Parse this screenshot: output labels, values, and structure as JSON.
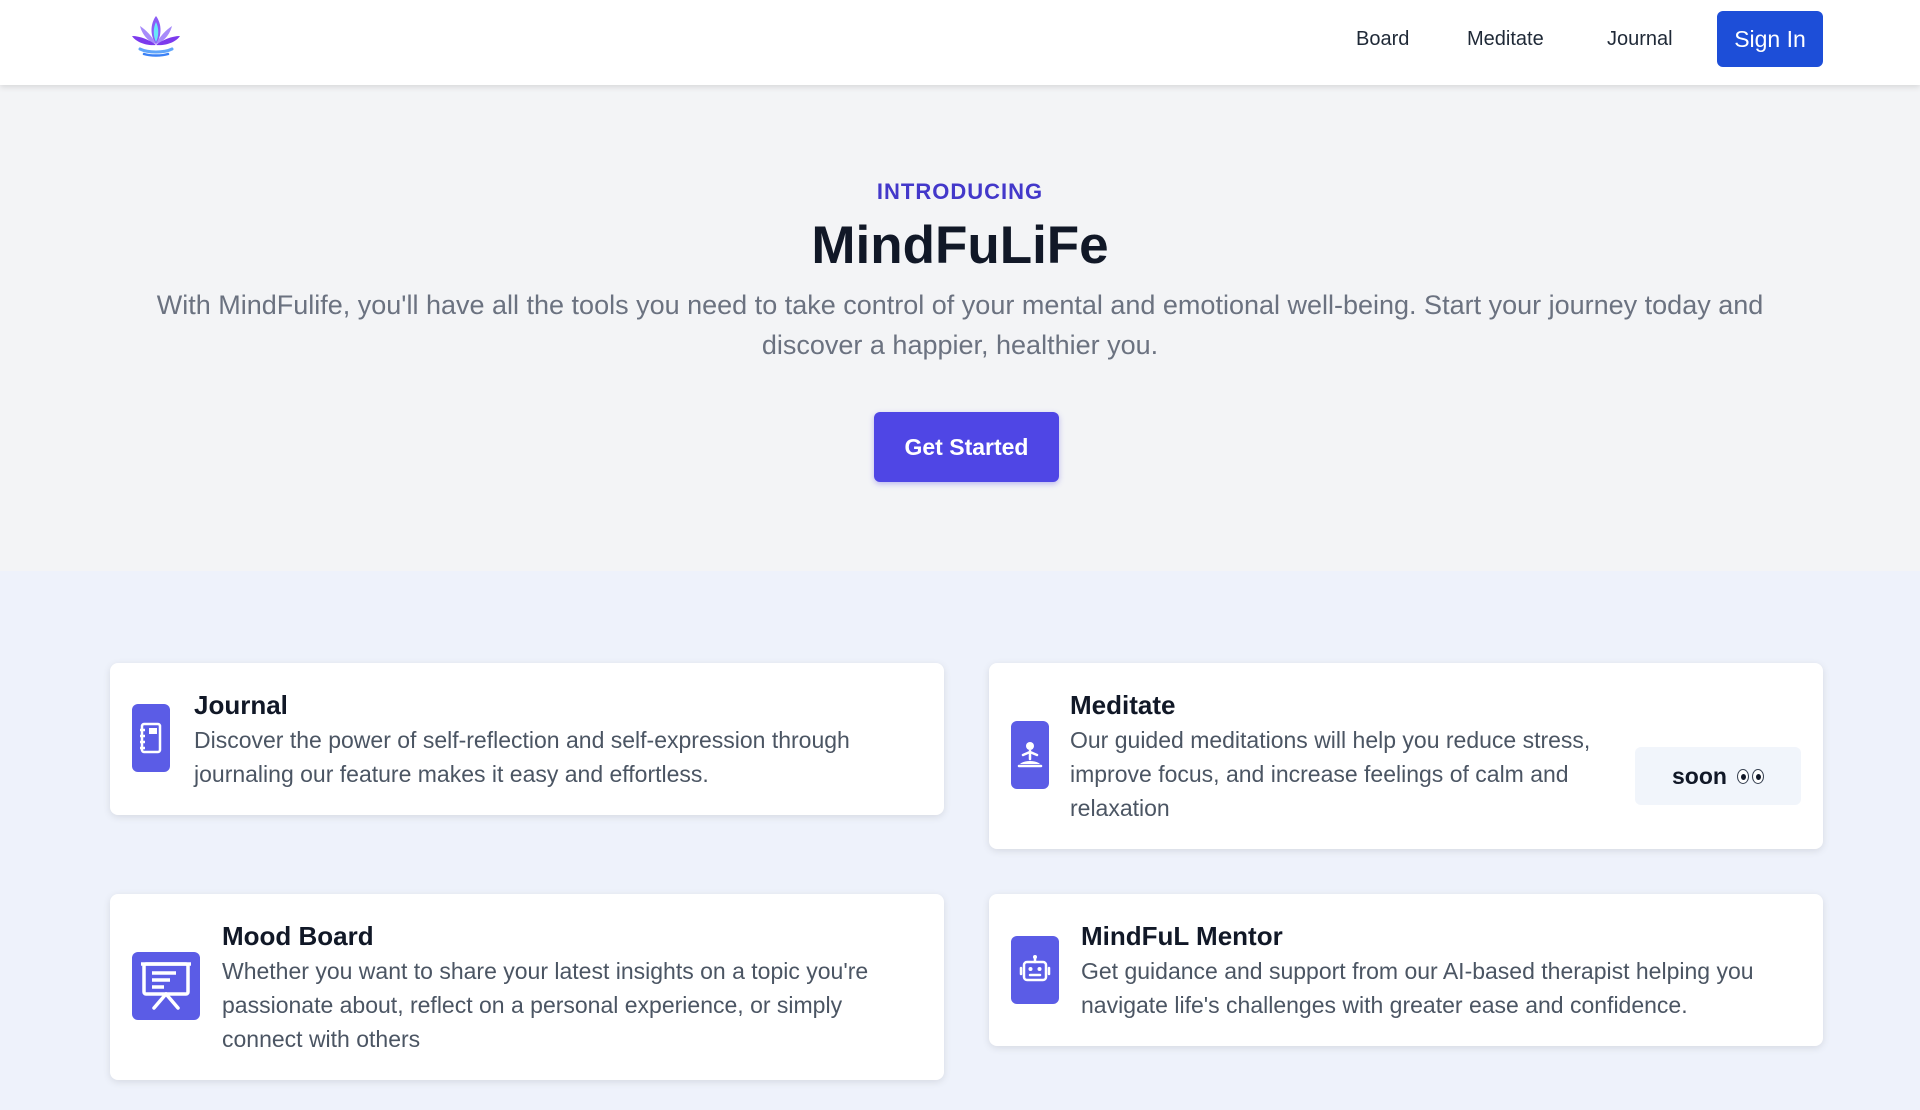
{
  "header": {
    "logo": {
      "name": "lotus-logo-icon",
      "colors": [
        "#7c3aed",
        "#60a5fa",
        "#a78bfa"
      ]
    },
    "nav": [
      {
        "label": "Board"
      },
      {
        "label": "Meditate"
      },
      {
        "label": "Journal"
      }
    ],
    "sign_in_label": "Sign In"
  },
  "hero": {
    "eyebrow": "INTRODUCING",
    "title": "MindFuLiFe",
    "subtitle": "With MindFulife, you'll have all the tools you need to take control of your mental and emotional well-being. Start your journey today and discover a happier, healthier you.",
    "cta_label": "Get Started"
  },
  "features": [
    {
      "title": "Journal",
      "description": "Discover the power of self-reflection and self-expression through journaling our feature makes it easy and effortless.",
      "icon": "journal-icon"
    },
    {
      "title": "Meditate",
      "description": "Our guided meditations will help you reduce stress, improve focus, and increase feelings of calm and relaxation",
      "icon": "meditation-icon",
      "badge": "soon",
      "badge_icon": "eyes-icon"
    },
    {
      "title": "Mood Board",
      "description": "Whether you want to share your latest insights on a topic you're passionate about, reflect on a personal experience, or simply connect with others",
      "icon": "presentation-board-icon"
    },
    {
      "title": "MindFuL Mentor",
      "description": "Get guidance and support from our AI-based therapist helping you navigate life's challenges with greater ease and confidence.",
      "icon": "robot-icon"
    }
  ],
  "colors": {
    "accent": "#4f46e5",
    "sign_in": "#1d4ed8",
    "eyebrow": "#4338ca",
    "icon_bg": "#5b5ce6"
  }
}
